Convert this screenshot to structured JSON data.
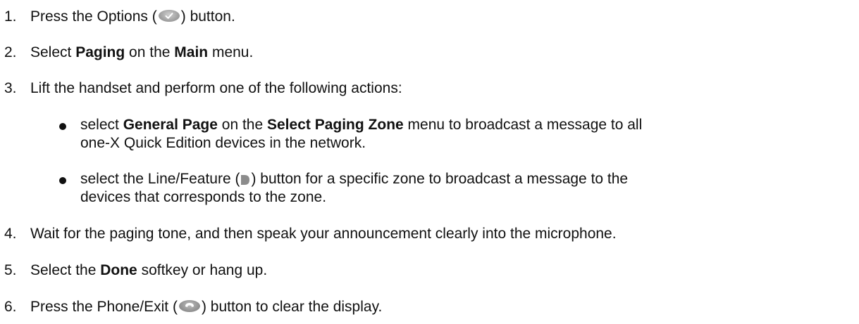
{
  "steps": [
    {
      "number": "1.",
      "pre": "Press the Options (",
      "icon": "options-icon",
      "post": ") button."
    },
    {
      "number": "2.",
      "pre": "Select ",
      "bold1": "Paging",
      "mid": " on the ",
      "bold2": "Main",
      "post": " menu."
    },
    {
      "number": "3.",
      "text": "Lift the handset and perform one of the following actions:"
    },
    {
      "number": "4.",
      "text": "Wait for the paging tone, and then speak your announcement clearly into the microphone."
    },
    {
      "number": "5.",
      "pre": "Select the ",
      "bold1": "Done",
      "post": " softkey or hang up."
    },
    {
      "number": "6.",
      "pre": "Press the Phone/Exit (",
      "icon": "phone-exit-icon",
      "post": ") button to clear the display."
    }
  ],
  "bullets": [
    {
      "pre": "select ",
      "bold1": "General Page",
      "mid": " on the ",
      "bold2": "Select Paging Zone",
      "post": " menu to broadcast a message to all",
      "line2": "one-X Quick Edition devices in the network."
    },
    {
      "pre": "select the Line/Feature (",
      "icon": "line-feature-icon",
      "post": ") button for a specific zone to broadcast a message to the",
      "line2": "devices that corresponds to the zone."
    }
  ],
  "colors": {
    "text": "#111111",
    "icon_gray": "#9a9a9a"
  }
}
